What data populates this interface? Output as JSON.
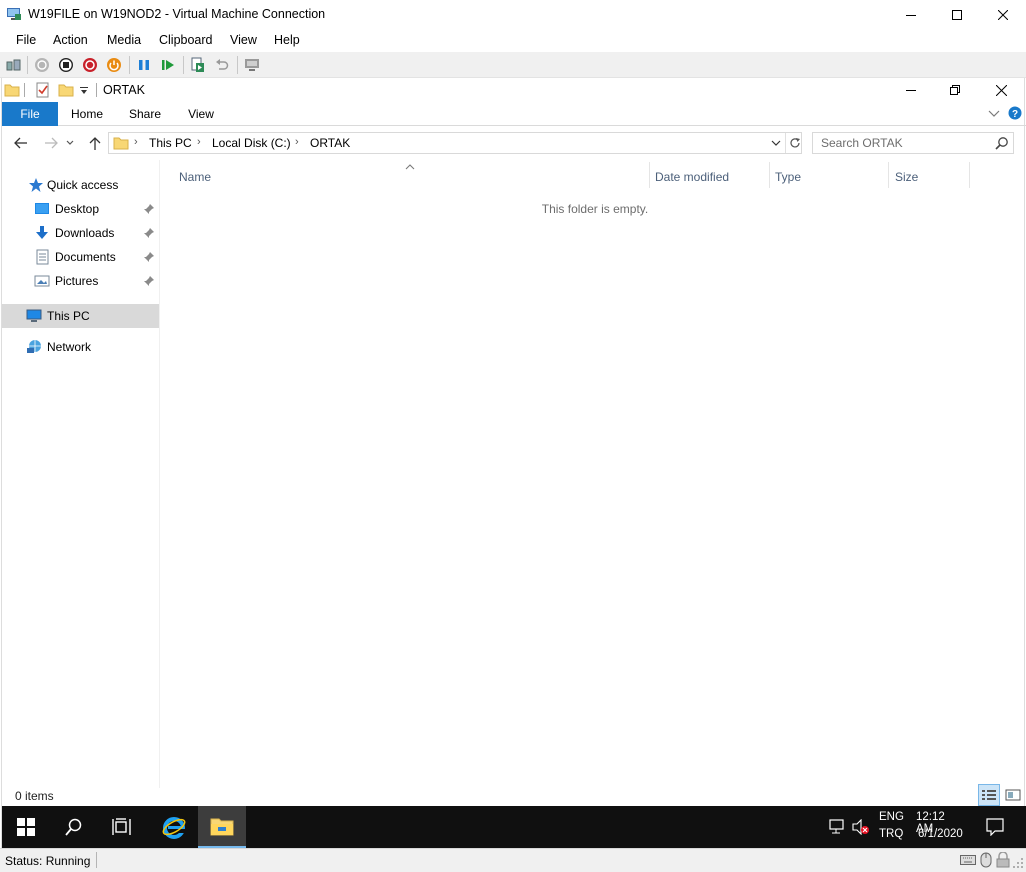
{
  "vm_window": {
    "title": "W19FILE on W19NOD2 - Virtual Machine Connection",
    "menu": [
      "File",
      "Action",
      "Media",
      "Clipboard",
      "View",
      "Help"
    ],
    "status": "Status: Running"
  },
  "explorer": {
    "title": "ORTAK",
    "ribbon_tabs": {
      "file": "File",
      "home": "Home",
      "share": "Share",
      "view": "View"
    },
    "breadcrumb": [
      "This PC",
      "Local Disk (C:)",
      "ORTAK"
    ],
    "search_placeholder": "Search ORTAK",
    "nav_pane": {
      "quick_access": "Quick access",
      "pinned": [
        "Desktop",
        "Downloads",
        "Documents",
        "Pictures"
      ],
      "this_pc": "This PC",
      "network": "Network"
    },
    "columns": {
      "name": "Name",
      "date_modified": "Date modified",
      "type": "Type",
      "size": "Size"
    },
    "empty_message": "This folder is empty.",
    "item_count": "0 items"
  },
  "taskbar": {
    "language_top": "ENG",
    "language_bottom": "TRQ",
    "time": "12:12 AM",
    "date": "6/1/2020"
  },
  "colors": {
    "file_tab": "#1979ca",
    "taskbar": "#101010",
    "selection": "#d9d9d9"
  }
}
